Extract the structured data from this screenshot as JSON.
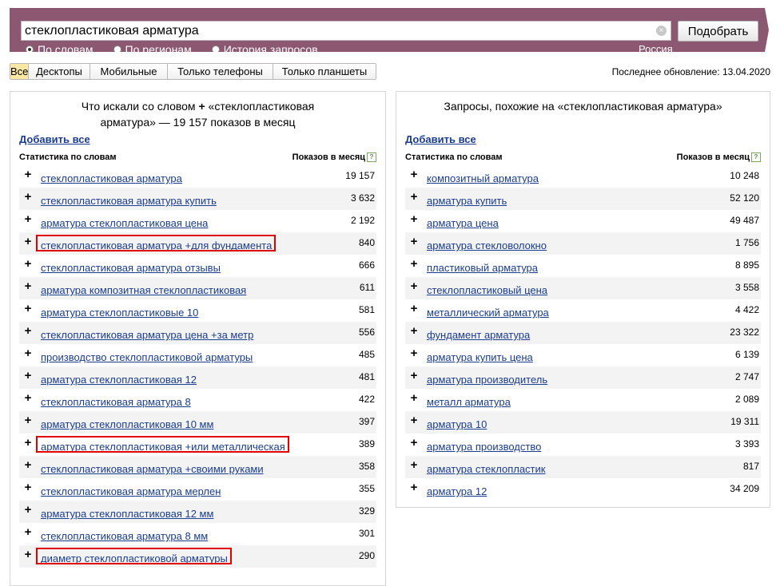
{
  "search": {
    "value": "стеклопластиковая арматура",
    "submit_label": "Подобрать",
    "clear_icon": "×",
    "modes": [
      {
        "label": "По словам",
        "selected": true
      },
      {
        "label": "По регионам",
        "selected": false
      },
      {
        "label": "История запросов",
        "selected": false
      }
    ],
    "region": "Россия"
  },
  "tabs": [
    {
      "label": "Все",
      "active": true
    },
    {
      "label": "Десктопы",
      "active": false
    },
    {
      "label": "Мобильные",
      "active": false
    },
    {
      "label": "Только телефоны",
      "active": false
    },
    {
      "label": "Только планшеты",
      "active": false
    }
  ],
  "last_update": "Последнее обновление: 13.04.2020",
  "left_panel": {
    "title_part1": "Что искали со словом",
    "title_part2": "«стеклопластиковая арматура» — 19 157 показов в месяц",
    "add_all": "Добавить все",
    "col_phrase": "Статистика по словам",
    "col_count": "Показов в месяц",
    "help_icon": "?",
    "rows": [
      {
        "phrase": "стеклопластиковая арматура",
        "count": "19 157",
        "highlighted": false
      },
      {
        "phrase": "стеклопластиковая арматура купить",
        "count": "3 632",
        "highlighted": false
      },
      {
        "phrase": "арматура стеклопластиковая цена",
        "count": "2 192",
        "highlighted": false
      },
      {
        "phrase": "стеклопластиковая арматура +для фундамента",
        "count": "840",
        "highlighted": true
      },
      {
        "phrase": "стеклопластиковая арматура отзывы",
        "count": "666",
        "highlighted": false
      },
      {
        "phrase": "арматура композитная стеклопластиковая",
        "count": "611",
        "highlighted": false
      },
      {
        "phrase": "арматура стеклопластиковые 10",
        "count": "581",
        "highlighted": false
      },
      {
        "phrase": "стеклопластиковая арматура цена +за метр",
        "count": "556",
        "highlighted": false
      },
      {
        "phrase": "производство стеклопластиковой арматуры",
        "count": "485",
        "highlighted": false
      },
      {
        "phrase": "арматура стеклопластиковая 12",
        "count": "481",
        "highlighted": false
      },
      {
        "phrase": "стеклопластиковая арматура 8",
        "count": "422",
        "highlighted": false
      },
      {
        "phrase": "арматура стеклопластиковая 10 мм",
        "count": "397",
        "highlighted": false
      },
      {
        "phrase": "арматура стеклопластиковая +или металлическая",
        "count": "389",
        "highlighted": true
      },
      {
        "phrase": "стеклопластиковая арматура +своими руками",
        "count": "358",
        "highlighted": false
      },
      {
        "phrase": "стеклопластиковая арматура мерлен",
        "count": "355",
        "highlighted": false
      },
      {
        "phrase": "арматура стеклопластиковая 12 мм",
        "count": "329",
        "highlighted": false
      },
      {
        "phrase": "стеклопластиковая арматура 8 мм",
        "count": "301",
        "highlighted": false
      },
      {
        "phrase": "диаметр стеклопластиковой арматуры",
        "count": "290",
        "highlighted": true
      }
    ]
  },
  "right_panel": {
    "title": "Запросы, похожие на «стеклопластиковая арматура»",
    "add_all": "Добавить все",
    "col_phrase": "Статистика по словам",
    "col_count": "Показов в месяц",
    "help_icon": "?",
    "rows": [
      {
        "phrase": "композитный арматура",
        "count": "10 248"
      },
      {
        "phrase": "арматура купить",
        "count": "52 120"
      },
      {
        "phrase": "арматура цена",
        "count": "49 487"
      },
      {
        "phrase": "арматура стекловолокно",
        "count": "1 756"
      },
      {
        "phrase": "пластиковый арматура",
        "count": "8 895"
      },
      {
        "phrase": "стеклопластиковый цена",
        "count": "3 558"
      },
      {
        "phrase": "металлический арматура",
        "count": "4 422"
      },
      {
        "phrase": "фундамент арматура",
        "count": "23 322"
      },
      {
        "phrase": "арматура купить цена",
        "count": "6 139"
      },
      {
        "phrase": "арматура производитель",
        "count": "2 747"
      },
      {
        "phrase": "металл арматура",
        "count": "2 089"
      },
      {
        "phrase": "арматура 10",
        "count": "19 311"
      },
      {
        "phrase": "арматура производство",
        "count": "3 393"
      },
      {
        "phrase": "арматура стеклопластик",
        "count": "817"
      },
      {
        "phrase": "арматура 12",
        "count": "34 209"
      }
    ]
  },
  "row_plus": "+"
}
